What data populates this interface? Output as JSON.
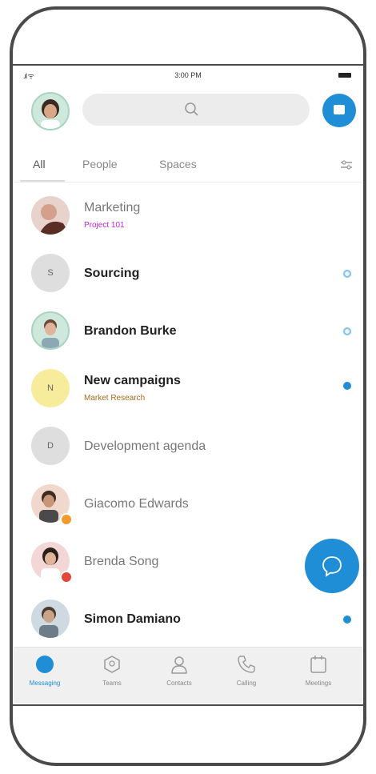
{
  "status": {
    "signal": ".ıl ᯤ",
    "time": "3:00 PM"
  },
  "search": {
    "placeholder": ""
  },
  "tabs": [
    {
      "label": "All",
      "active": true
    },
    {
      "label": "People"
    },
    {
      "label": "Spaces"
    }
  ],
  "conversations": [
    {
      "name": "Marketing",
      "subtitle": "Project 101",
      "subtitle_color": "#c026d3",
      "bold": false,
      "avatar": "photo",
      "indicator": "none"
    },
    {
      "name": "Sourcing",
      "initial": "S",
      "bold": true,
      "avatar": "initial",
      "avatar_color": "#dedede",
      "indicator": "ring"
    },
    {
      "name": "Brandon Burke",
      "bold": true,
      "avatar": "photo",
      "indicator": "ring"
    },
    {
      "name": "New campaigns",
      "subtitle": "Market Research",
      "subtitle_color": "#a36b1e",
      "initial": "N",
      "bold": true,
      "avatar": "initial",
      "avatar_color": "#f7ec9c",
      "indicator": "solid"
    },
    {
      "name": "Development agenda",
      "initial": "D",
      "bold": false,
      "avatar": "initial",
      "avatar_color": "#dedede",
      "indicator": "none"
    },
    {
      "name": "Giacomo Edwards",
      "bold": false,
      "avatar": "photo",
      "indicator": "none"
    },
    {
      "name": "Brenda Song",
      "bold": false,
      "avatar": "photo",
      "indicator": "none"
    },
    {
      "name": "Simon Damiano",
      "bold": true,
      "avatar": "photo",
      "indicator": "solid"
    }
  ],
  "nav": [
    {
      "label": "Messaging",
      "icon": "messaging-icon",
      "active": true
    },
    {
      "label": "Teams",
      "icon": "teams-icon"
    },
    {
      "label": "Contacts",
      "icon": "contacts-icon"
    },
    {
      "label": "Calling",
      "icon": "calling-icon"
    },
    {
      "label": "Meetings",
      "icon": "meetings-icon"
    }
  ],
  "colors": {
    "accent": "#1f8ed6",
    "frame": "#4a4a4a"
  }
}
